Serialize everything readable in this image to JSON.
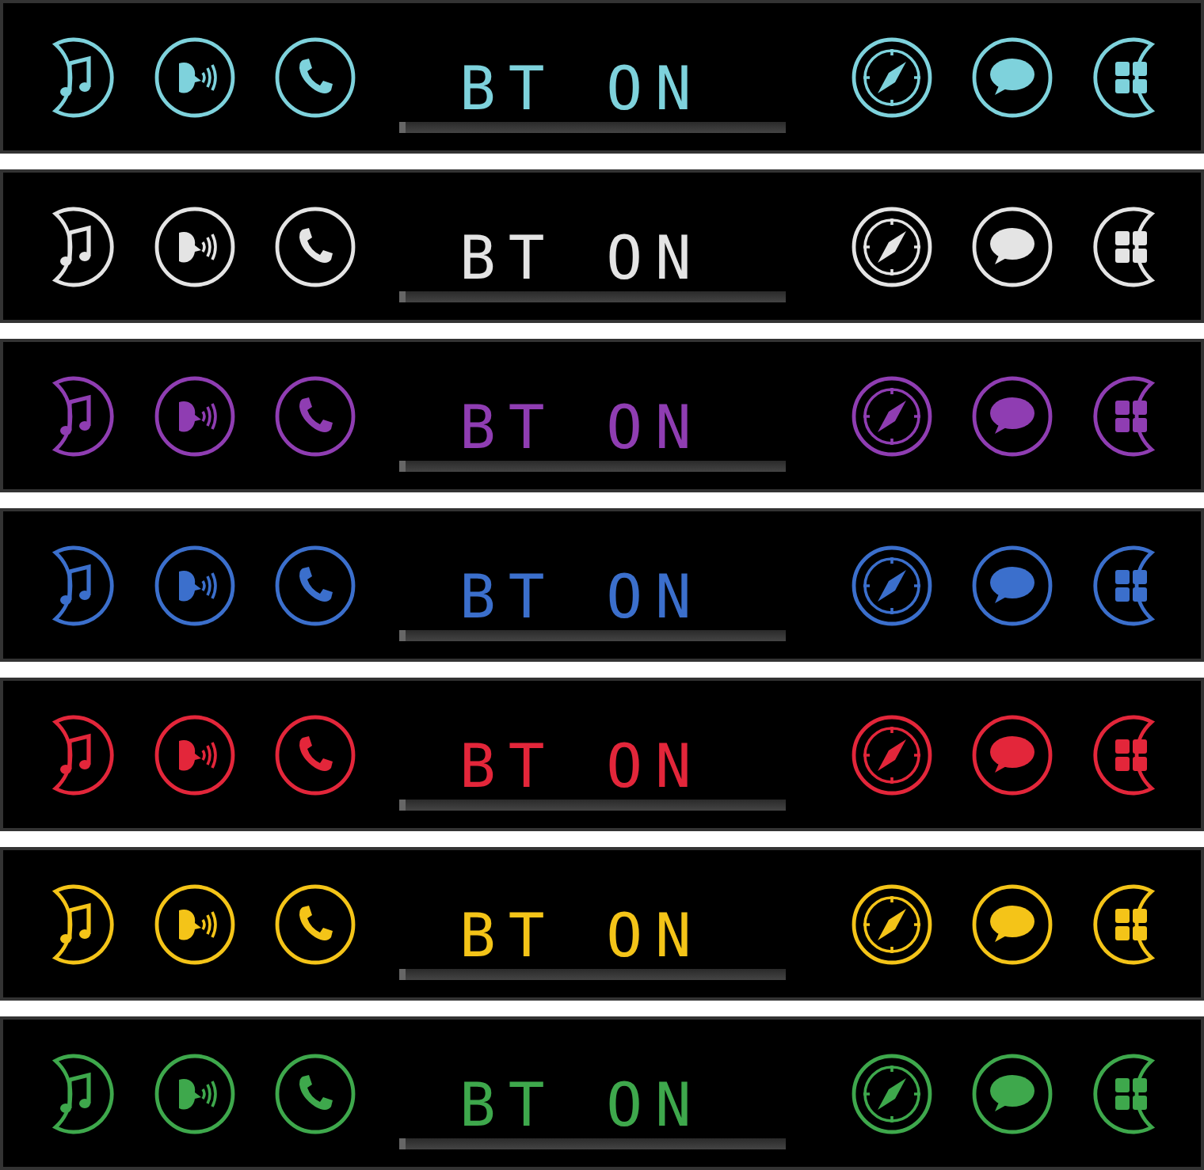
{
  "themes": [
    {
      "color": "#7ed2dc",
      "display_text": "BT ON"
    },
    {
      "color": "#e4e4e4",
      "display_text": "BT ON"
    },
    {
      "color": "#8f3db2",
      "display_text": "BT ON"
    },
    {
      "color": "#3b6fcc",
      "display_text": "BT ON"
    },
    {
      "color": "#e3263a",
      "display_text": "BT ON"
    },
    {
      "color": "#f4c418",
      "display_text": "BT ON"
    },
    {
      "color": "#3ea84c",
      "display_text": "BT ON"
    }
  ]
}
